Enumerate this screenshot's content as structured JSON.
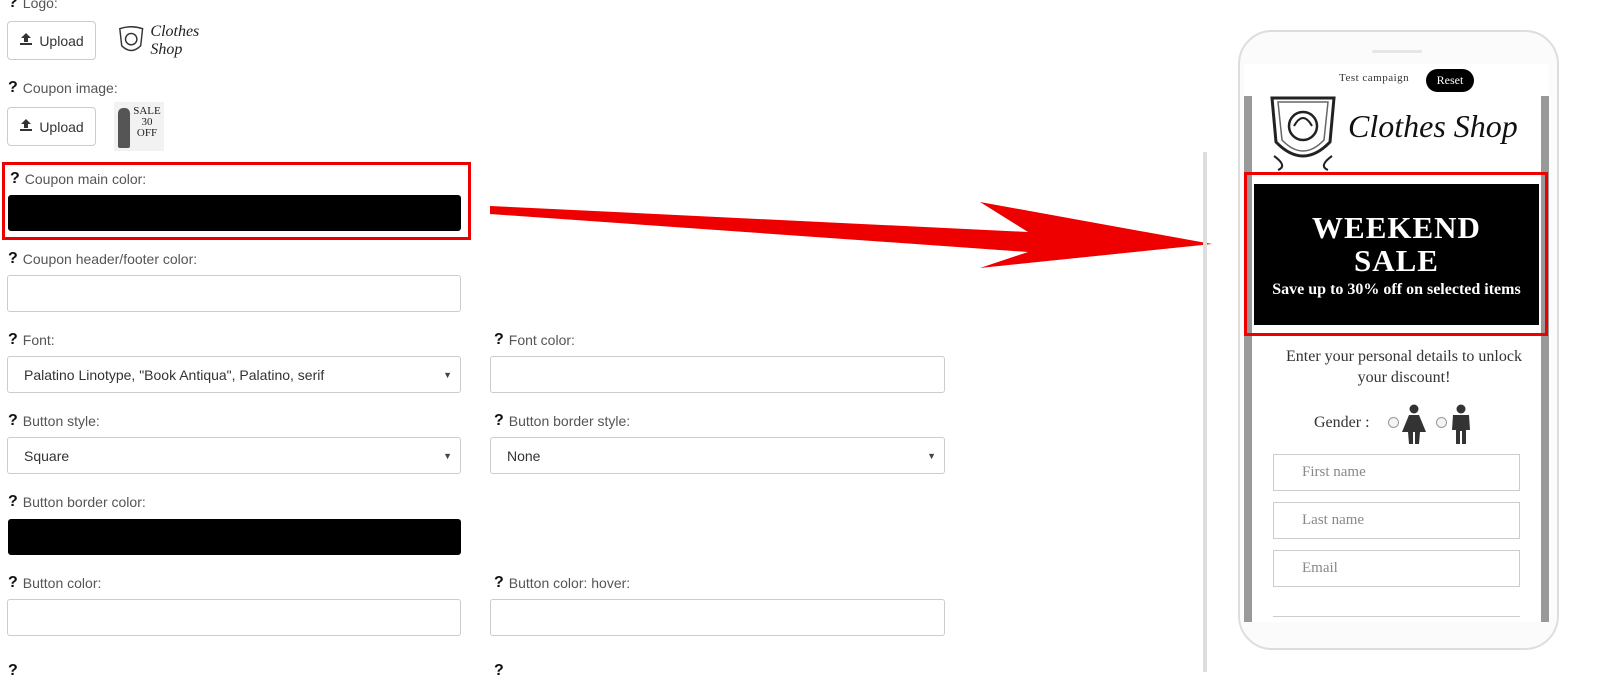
{
  "form": {
    "logo": {
      "label": "Logo:",
      "upload_label": "Upload",
      "preview_text": "Clothes Shop"
    },
    "coupon_image": {
      "label": "Coupon image:",
      "upload_label": "Upload",
      "preview_lines": [
        "SALE",
        "30",
        "OFF"
      ]
    },
    "coupon_main_color": {
      "label": "Coupon main color:",
      "value": "#000000"
    },
    "coupon_header_footer_color": {
      "label": "Coupon header/footer color:",
      "value": ""
    },
    "font": {
      "label": "Font:",
      "value": "Palatino Linotype, \"Book Antiqua\", Palatino, serif"
    },
    "font_color": {
      "label": "Font color:",
      "value": ""
    },
    "button_style": {
      "label": "Button style:",
      "value": "Square"
    },
    "button_border_style": {
      "label": "Button border style:",
      "value": "None"
    },
    "button_border_color": {
      "label": "Button border color:",
      "value": "#000000"
    },
    "button_color": {
      "label": "Button color:",
      "value": ""
    },
    "button_color_hover": {
      "label": "Button color: hover:",
      "value": ""
    }
  },
  "preview": {
    "test_campaign_label": "Test campaign",
    "reset_label": "Reset",
    "logo_text": "Clothes Shop",
    "coupon_title": "WEEKEND SALE",
    "coupon_subtitle": "Save up to 30% off on selected items",
    "instructions": "Enter your personal details to unlock your discount!",
    "gender_label": "Gender :",
    "first_name_placeholder": "First name",
    "last_name_placeholder": "Last name",
    "email_placeholder": "Email"
  },
  "colors": {
    "highlight": "#e00000",
    "coupon_bg": "#000000",
    "arrow": "#ee0000"
  }
}
